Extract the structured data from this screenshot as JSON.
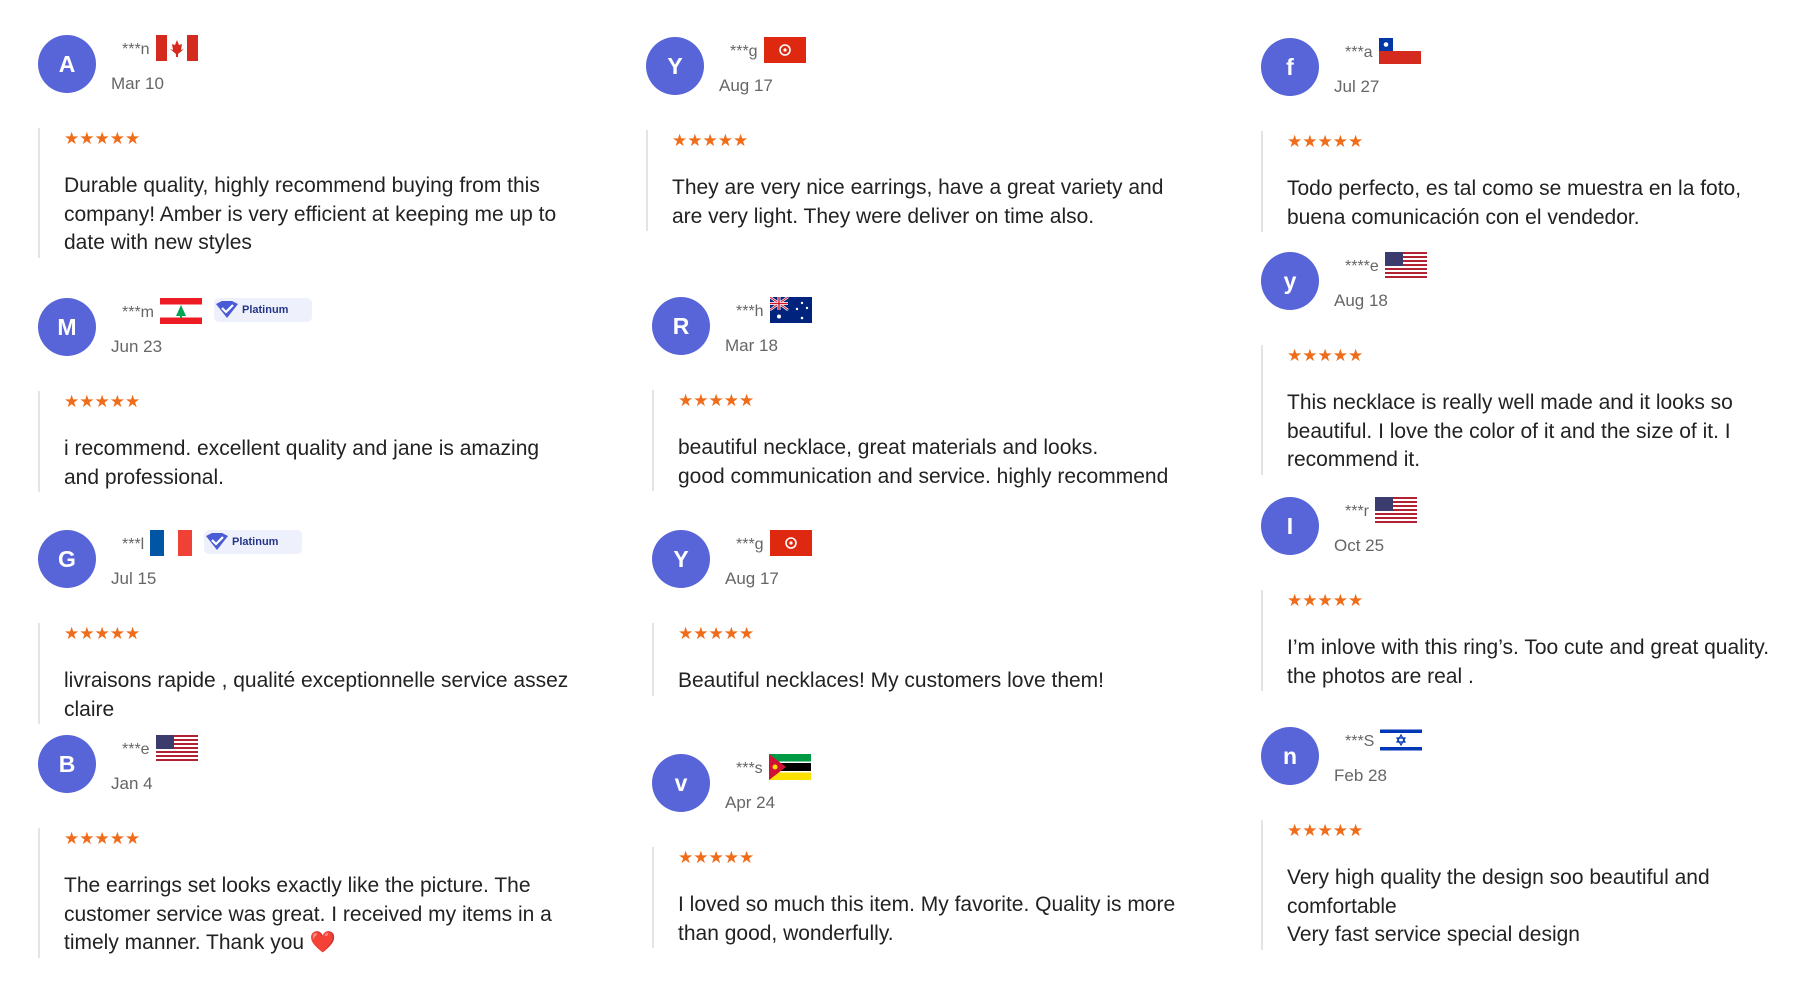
{
  "stars": "★★★★★",
  "badge_label": "Platinum",
  "colors": {
    "avatar_bg": "#5865d8",
    "star": "#ef6c1a",
    "badge_text": "#25348a",
    "heart": "#e0242a"
  },
  "reviews": [
    {
      "initial": "A",
      "name": "***n",
      "flag": "canada",
      "date": "Mar 10",
      "rating": 5,
      "text": "Durable quality, highly recommend buying from this\ncompany! Amber is very efficient at keeping me up to\ndate with new styles"
    },
    {
      "initial": "M",
      "name": "***m",
      "flag": "lebanon",
      "platinum": true,
      "date": "Jun 23",
      "rating": 5,
      "text": "i recommend. excellent quality and jane is amazing\nand professional."
    },
    {
      "initial": "G",
      "name": "***l",
      "flag": "france",
      "platinum": true,
      "date": "Jul 15",
      "rating": 5,
      "text": "livraisons rapide , qualité exceptionnelle service assez\nclaire"
    },
    {
      "initial": "B",
      "name": "***e",
      "flag": "usa",
      "date": "Jan 4",
      "rating": 5,
      "text": "The earrings set looks exactly like the picture. The\ncustomer service was great. I received my items in a\ntimely manner. Thank you",
      "emoji": "heart-emoji"
    },
    {
      "initial": "Y",
      "name": "***g",
      "flag": "hongkong",
      "date": "Aug 17",
      "rating": 5,
      "text": "They are very nice earrings, have a great variety and\nare very light. They were deliver on time also."
    },
    {
      "initial": "R",
      "name": "***h",
      "flag": "australia",
      "date": "Mar 18",
      "rating": 5,
      "text": "beautiful necklace, great materials and looks.\ngood communication and service. highly recommend"
    },
    {
      "initial": "Y",
      "name": "***g",
      "flag": "hongkong",
      "date": "Aug 17",
      "rating": 5,
      "text": "Beautiful necklaces! My customers love them!"
    },
    {
      "initial": "v",
      "name": "***s",
      "flag": "mozambique",
      "date": "Apr 24",
      "rating": 5,
      "text": "I loved so much this item. My favorite. Quality is more\nthan good, wonderfully."
    },
    {
      "initial": "f",
      "name": "***a",
      "flag": "chile",
      "date": "Jul 27",
      "rating": 5,
      "text": "Todo perfecto, es tal como se muestra en la foto,\nbuena comunicación con el vendedor."
    },
    {
      "initial": "y",
      "name": "****e",
      "flag": "usa",
      "date": "Aug 18",
      "rating": 5,
      "text": "This necklace is really well made and it looks so\nbeautiful. I love the color of it and the size of it. I\nrecommend it."
    },
    {
      "initial": "I",
      "name": "***r",
      "flag": "usa",
      "date": "Oct 25",
      "rating": 5,
      "text": "I’m inlove with this ring’s. Too cute and great quality.\nthe photos are real ."
    },
    {
      "initial": "n",
      "name": "***S",
      "flag": "israel",
      "date": "Feb 28",
      "rating": 5,
      "text": "Very high quality the design soo beautiful and\ncomfortable\nVery fast service special design"
    }
  ]
}
